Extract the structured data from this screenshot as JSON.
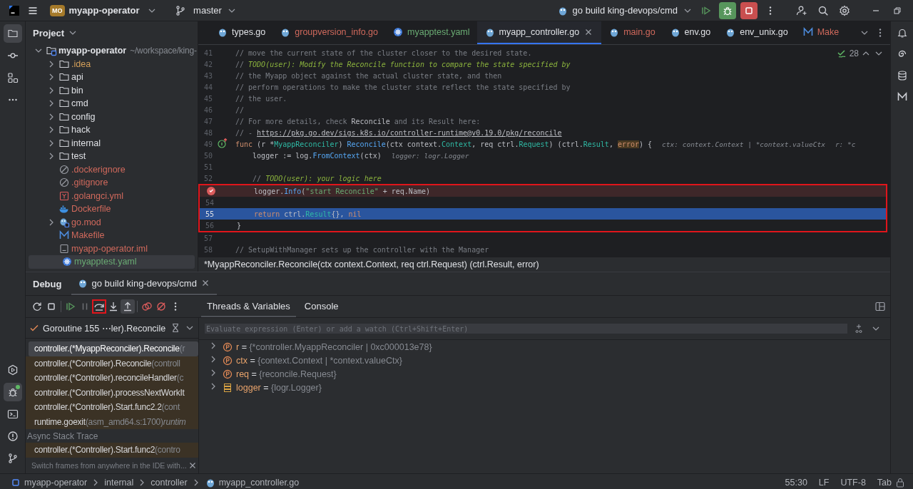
{
  "title_bar": {
    "project_badge": "MO",
    "project": "myapp-operator",
    "branch": "master",
    "run_config": "go build king-devops/cmd"
  },
  "left_tool_windows": [
    {
      "kind": "project",
      "selected": true
    },
    {
      "kind": "commit",
      "selected": false
    },
    {
      "kind": "structure",
      "selected": false
    },
    {
      "kind": "more",
      "selected": false
    },
    {
      "kind": "services",
      "selected": false
    },
    {
      "kind": "debug",
      "selected": true
    },
    {
      "kind": "terminal",
      "selected": false
    },
    {
      "kind": "problems",
      "selected": false
    },
    {
      "kind": "git",
      "selected": false
    }
  ],
  "project_panel": {
    "title": "Project",
    "tree": [
      {
        "name": "myapp-operator",
        "path": "~/workspace/king-",
        "kind": "module",
        "expanded": true,
        "selected": false,
        "color": "#dfe1e5",
        "children": [
          {
            "name": ".idea",
            "kind": "folder",
            "expanded": false,
            "selected": false,
            "color": "#d5a05a"
          },
          {
            "name": "api",
            "kind": "folder",
            "expanded": false,
            "selected": false,
            "color": "#dfe1e5"
          },
          {
            "name": "bin",
            "kind": "folder",
            "expanded": false,
            "selected": false,
            "color": "#dfe1e5"
          },
          {
            "name": "cmd",
            "kind": "folder",
            "expanded": false,
            "selected": false,
            "color": "#dfe1e5"
          },
          {
            "name": "config",
            "kind": "folder",
            "expanded": false,
            "selected": false,
            "color": "#dfe1e5"
          },
          {
            "name": "hack",
            "kind": "folder",
            "expanded": false,
            "selected": false,
            "color": "#dfe1e5"
          },
          {
            "name": "internal",
            "kind": "folder",
            "expanded": false,
            "selected": false,
            "color": "#dfe1e5"
          },
          {
            "name": "test",
            "kind": "folder",
            "expanded": false,
            "selected": false,
            "color": "#dfe1e5"
          },
          {
            "name": ".dockerignore",
            "kind": "ignore",
            "selected": false,
            "color": "#d0695c"
          },
          {
            "name": ".gitignore",
            "kind": "ignore",
            "selected": false,
            "color": "#d0695c"
          },
          {
            "name": ".golangci.yml",
            "kind": "lint",
            "selected": false,
            "color": "#d0695c"
          },
          {
            "name": "Dockerfile",
            "kind": "docker",
            "selected": false,
            "color": "#d0695c"
          },
          {
            "name": "go.mod",
            "kind": "gomod",
            "expanded": false,
            "selected": false,
            "color": "#d0695c"
          },
          {
            "name": "Makefile",
            "kind": "makefile",
            "selected": false,
            "color": "#d0695c"
          },
          {
            "name": "myapp-operator.iml",
            "kind": "iml",
            "selected": false,
            "color": "#d0695c"
          },
          {
            "name": "myapptest.yaml",
            "kind": "yaml",
            "selected": true,
            "color": "#6aab73"
          }
        ]
      }
    ]
  },
  "editor": {
    "tabs": [
      {
        "label": "types.go",
        "kind": "go",
        "selected": false,
        "color": "#dfe1e5"
      },
      {
        "label": "groupversion_info.go",
        "kind": "go",
        "selected": false,
        "color": "#d0695c"
      },
      {
        "label": "myapptest.yaml",
        "kind": "yaml",
        "selected": false,
        "color": "#6aab73"
      },
      {
        "label": "myapp_controller.go",
        "kind": "go",
        "selected": true,
        "color": "#dfe1e5"
      },
      {
        "label": "main.go",
        "kind": "go",
        "selected": false,
        "color": "#d0695c"
      },
      {
        "label": "env.go",
        "kind": "go",
        "selected": false,
        "color": "#dfe1e5"
      },
      {
        "label": "env_unix.go",
        "kind": "go",
        "selected": false,
        "color": "#dfe1e5"
      },
      {
        "label": "Make",
        "kind": "makefile",
        "selected": false,
        "color": "#d0695c"
      }
    ],
    "inspections": "28",
    "lines": [
      {
        "number": "41",
        "breakpoint": false,
        "current": false,
        "boxed": false,
        "code": [
          {
            "kind": "comment",
            "text": "// move the current state of the cluster closer to the desired state."
          }
        ]
      },
      {
        "number": "42",
        "breakpoint": false,
        "current": false,
        "boxed": false,
        "code": [
          {
            "kind": "comment",
            "text": "// "
          },
          {
            "kind": "todo",
            "text": "TODO(user): Modify the Reconcile function to compare the state specified by"
          }
        ]
      },
      {
        "number": "43",
        "breakpoint": false,
        "current": false,
        "boxed": false,
        "code": [
          {
            "kind": "comment",
            "text": "// the Myapp object against the actual cluster state, and then"
          }
        ]
      },
      {
        "number": "44",
        "breakpoint": false,
        "current": false,
        "boxed": false,
        "code": [
          {
            "kind": "comment",
            "text": "// perform operations to make the cluster state reflect the state specified by"
          }
        ]
      },
      {
        "number": "45",
        "breakpoint": false,
        "current": false,
        "boxed": false,
        "code": [
          {
            "kind": "comment",
            "text": "// the user."
          }
        ]
      },
      {
        "number": "46",
        "breakpoint": false,
        "current": false,
        "boxed": false,
        "code": [
          {
            "kind": "comment",
            "text": "//"
          }
        ]
      },
      {
        "number": "47",
        "breakpoint": false,
        "current": false,
        "boxed": false,
        "code": [
          {
            "kind": "comment",
            "text": "// For more details, check "
          },
          {
            "kind": "ref",
            "text": "Reconcile"
          },
          {
            "kind": "comment",
            "text": " and its Result here:"
          }
        ]
      },
      {
        "number": "48",
        "breakpoint": false,
        "current": false,
        "boxed": false,
        "code": [
          {
            "kind": "comment",
            "text": "// - "
          },
          {
            "kind": "link",
            "text": "https://pkg.go.dev/sigs.k8s.io/controller-runtime@v0.19.0/pkg/reconcile"
          }
        ]
      },
      {
        "number": "49",
        "implements": true,
        "breakpoint": false,
        "current": false,
        "boxed": false,
        "code": [
          {
            "kind": "keyword",
            "text": "func"
          },
          {
            "kind": "plain",
            "text": " (r *"
          },
          {
            "kind": "type",
            "text": "MyappReconciler"
          },
          {
            "kind": "plain",
            "text": ") "
          },
          {
            "kind": "func",
            "text": "Reconcile"
          },
          {
            "kind": "plain",
            "text": "(ctx context."
          },
          {
            "kind": "type",
            "text": "Context"
          },
          {
            "kind": "plain",
            "text": ", req ctrl."
          },
          {
            "kind": "type",
            "text": "Request"
          },
          {
            "kind": "plain",
            "text": ") (ctrl."
          },
          {
            "kind": "type",
            "text": "Result"
          },
          {
            "kind": "plain",
            "text": ", "
          },
          {
            "kind": "error",
            "text": "error"
          },
          {
            "kind": "plain",
            "text": ") {"
          }
        ],
        "hints": [
          "ctx: context.Context | *context.valueCtx",
          "r: *c"
        ]
      },
      {
        "number": "50",
        "breakpoint": false,
        "current": false,
        "boxed": false,
        "code": [
          {
            "kind": "plain",
            "text": "    logger := log."
          },
          {
            "kind": "func",
            "text": "FromContext"
          },
          {
            "kind": "plain",
            "text": "(ctx)"
          }
        ],
        "hints": [
          "logger: logr.Logger"
        ]
      },
      {
        "number": "51",
        "breakpoint": false,
        "current": false,
        "boxed": false
      },
      {
        "number": "52",
        "breakpoint": false,
        "current": false,
        "boxed": false,
        "code": [
          {
            "kind": "comment",
            "text": "    // "
          },
          {
            "kind": "todo",
            "text": "TODO(user): your logic here"
          }
        ]
      },
      {
        "breakpoint": true,
        "current": false,
        "boxed": true,
        "code": [
          {
            "kind": "plain",
            "text": "    logger."
          },
          {
            "kind": "func",
            "text": "Info"
          },
          {
            "kind": "plain",
            "text": "("
          },
          {
            "kind": "string",
            "text": "\"start Reconcile\""
          },
          {
            "kind": "plain",
            "text": " + req.Name)"
          }
        ]
      },
      {
        "number": "54",
        "breakpoint": false,
        "current": false,
        "boxed": true
      },
      {
        "number": "55",
        "breakpoint": false,
        "current": true,
        "boxed": true,
        "code": [
          {
            "kind": "keyword",
            "text": "    return"
          },
          {
            "kind": "plain",
            "text": " ctrl."
          },
          {
            "kind": "type",
            "text": "Result"
          },
          {
            "kind": "plain",
            "text": "{}, "
          },
          {
            "kind": "keyword",
            "text": "nil"
          }
        ]
      },
      {
        "number": "56",
        "breakpoint": false,
        "current": false,
        "boxed": true,
        "code": [
          {
            "kind": "plain",
            "text": "}"
          }
        ]
      },
      {
        "number": "57",
        "breakpoint": false,
        "current": false,
        "boxed": false
      },
      {
        "number": "58",
        "breakpoint": false,
        "current": false,
        "boxed": false,
        "code": [
          {
            "kind": "comment",
            "text": "// SetupWithManager sets up the controller with the Manager"
          }
        ]
      }
    ],
    "signature": "*MyappReconciler.Reconcile(ctx context.Context, req ctrl.Request) (ctrl.Result, error)"
  },
  "debug": {
    "title": "Debug",
    "session_tab": {
      "label": "go build king-devops/cmd",
      "selected": true
    },
    "toolbar": [
      {
        "kind": "rerun",
        "disabled": false,
        "boxed": false,
        "active": false
      },
      {
        "kind": "stop",
        "disabled": false,
        "boxed": false,
        "active": false
      },
      {
        "kind": "resume",
        "disabled": false,
        "boxed": false,
        "active": false
      },
      {
        "kind": "pause",
        "disabled": true,
        "boxed": false,
        "active": false
      },
      {
        "kind": "step-over",
        "disabled": false,
        "boxed": true,
        "active": false
      },
      {
        "kind": "step-into",
        "disabled": false,
        "boxed": false,
        "active": false
      },
      {
        "kind": "step-out",
        "disabled": false,
        "boxed": false,
        "active": true
      },
      {
        "kind": "breakpoints",
        "disabled": false,
        "boxed": false,
        "active": false
      },
      {
        "kind": "mute",
        "disabled": false,
        "boxed": false,
        "active": false
      },
      {
        "kind": "more",
        "disabled": false,
        "boxed": false,
        "active": false
      }
    ],
    "view_tabs": [
      {
        "label": "Threads & Variables",
        "selected": true
      },
      {
        "label": "Console",
        "selected": false
      }
    ],
    "thread": "Goroutine 155 ⋯ler).Reconcile",
    "frames": [
      {
        "kind": "frame",
        "name": "controller.(*MyappReconciler).Reconcile",
        "detail": "(r",
        "library": false,
        "selected": true
      },
      {
        "kind": "frame",
        "name": "controller.(*Controller).Reconcile",
        "detail": "(controll",
        "library": true,
        "selected": false
      },
      {
        "kind": "frame",
        "name": "controller.(*Controller).reconcileHandler",
        "detail": "(c",
        "library": true,
        "selected": false
      },
      {
        "kind": "frame",
        "name": "controller.(*Controller).processNextWorkIt",
        "library": true,
        "selected": false
      },
      {
        "kind": "frame",
        "name": "controller.(*Controller).Start.func2.2",
        "detail": "(cont",
        "library": true,
        "selected": false
      },
      {
        "kind": "frame",
        "name": "runtime.goexit",
        "detail": "(asm_amd64.s:1700)",
        "package": "runtim",
        "library": true,
        "selected": false
      },
      {
        "kind": "header",
        "name": "Async Stack Trace"
      },
      {
        "kind": "frame",
        "name": "controller.(*Controller).Start.func2",
        "detail": "(contro",
        "library": true,
        "selected": false
      }
    ],
    "hint": "Switch frames from anywhere in the IDE with...",
    "evaluate_placeholder": "Evaluate expression (Enter) or add a watch (Ctrl+Shift+Enter)",
    "variables": [
      {
        "name": "r",
        "operator": "=",
        "value": "{*controller.MyappReconciler | 0xc000013e78}",
        "kind": "param",
        "expanded": false
      },
      {
        "name": "ctx",
        "operator": "=",
        "value": "{context.Context | *context.valueCtx}",
        "kind": "param",
        "expanded": false
      },
      {
        "name": "req",
        "operator": "=",
        "value": "{reconcile.Request}",
        "kind": "param",
        "expanded": false
      },
      {
        "name": "logger",
        "operator": "=",
        "value": "{logr.Logger}",
        "kind": "local",
        "expanded": false
      }
    ]
  },
  "status_bar": {
    "breadcrumbs": [
      {
        "label": "myapp-operator",
        "kind": "module"
      },
      {
        "label": "internal",
        "kind": "folder"
      },
      {
        "label": "controller",
        "kind": "folder"
      },
      {
        "label": "myapp_controller.go",
        "kind": "go"
      }
    ],
    "position": "55:30",
    "line_separator": "LF",
    "encoding": "UTF-8",
    "indent": "Tab"
  }
}
